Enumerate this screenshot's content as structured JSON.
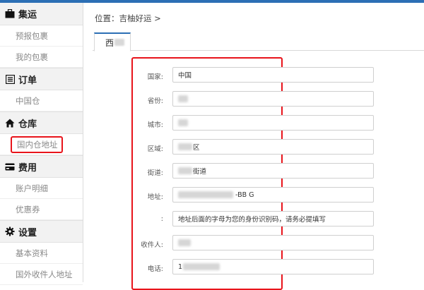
{
  "sidebar": {
    "sections": [
      {
        "icon": "briefcase-icon",
        "title": "集运",
        "items": [
          "预报包裹",
          "我的包裹"
        ]
      },
      {
        "icon": "list-icon",
        "title": "订单",
        "items": [
          "中国仓"
        ]
      },
      {
        "icon": "home-icon",
        "title": "仓库",
        "items": [
          "国内仓地址"
        ]
      },
      {
        "icon": "credit-card-icon",
        "title": "费用",
        "items": [
          "账户明细",
          "优惠券"
        ]
      },
      {
        "icon": "gear-icon",
        "title": "设置",
        "items": [
          "基本资料",
          "国外收件人地址"
        ]
      }
    ],
    "active_item": "国内仓地址"
  },
  "breadcrumb": {
    "text": "位置：吉柚好运 >"
  },
  "tab": {
    "label": "西"
  },
  "form": {
    "rows": [
      {
        "label": "国家:",
        "value": "中国"
      },
      {
        "label": "省份:",
        "value": ""
      },
      {
        "label": "城市:",
        "value": ""
      },
      {
        "label": "区域:",
        "value": "区"
      },
      {
        "label": "街道:",
        "value": "街道"
      },
      {
        "label": "地址:",
        "value": "-BB G"
      },
      {
        "label": ":",
        "value": "地址后面的字母为您的身份识别码，请务必提填写"
      },
      {
        "label": "收件人:",
        "value": ""
      },
      {
        "label": "电话:",
        "value": "1"
      }
    ]
  }
}
